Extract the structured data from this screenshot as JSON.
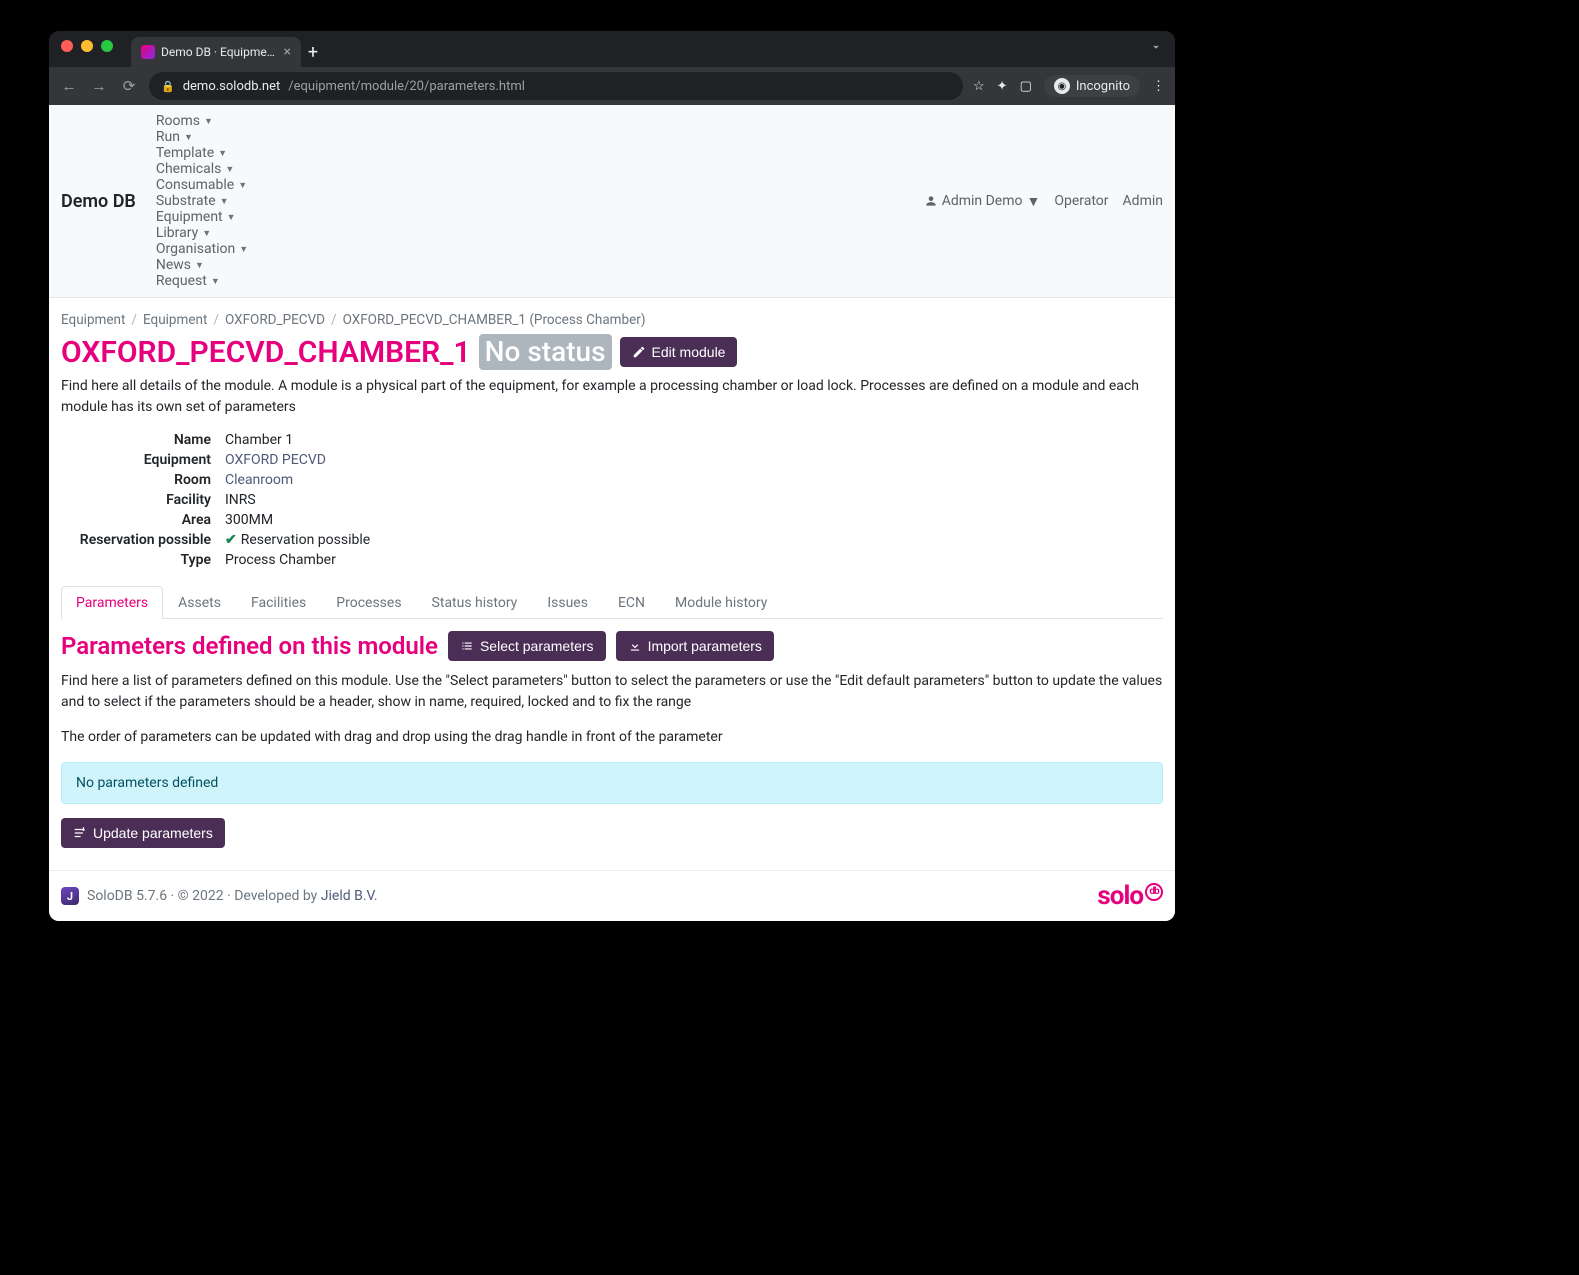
{
  "window": {
    "tab_title": "Demo DB · Equipment · Module",
    "incognito_label": "Incognito"
  },
  "url": {
    "host": "demo.solodb.net",
    "path": "/equipment/module/20/parameters.html"
  },
  "navbar": {
    "brand": "Demo DB",
    "items": [
      "Rooms",
      "Run",
      "Template",
      "Chemicals",
      "Consumable",
      "Substrate",
      "Equipment",
      "Library",
      "Organisation",
      "News",
      "Request"
    ],
    "user_label": "Admin Demo",
    "links": [
      "Operator",
      "Admin"
    ]
  },
  "breadcrumb": {
    "items": [
      "Equipment",
      "Equipment",
      "OXFORD_PECVD"
    ],
    "active": "OXFORD_PECVD_CHAMBER_1 (Process Chamber)"
  },
  "header": {
    "title": "OXFORD_PECVD_CHAMBER_1",
    "status": "No status",
    "edit_label": "Edit module",
    "lead": "Find here all details of the module. A module is a physical part of the equipment, for example a processing chamber or load lock. Processes are defined on a module and each module has its own set of parameters"
  },
  "details": {
    "rows": [
      {
        "label": "Name",
        "value": "Chamber 1"
      },
      {
        "label": "Equipment",
        "value": "OXFORD PECVD",
        "link": true
      },
      {
        "label": "Room",
        "value": "Cleanroom",
        "link": true
      },
      {
        "label": "Facility",
        "value": "INRS"
      },
      {
        "label": "Area",
        "value": "300MM"
      },
      {
        "label": "Reservation possible",
        "value": "Reservation possible",
        "check": true
      },
      {
        "label": "Type",
        "value": "Process Chamber"
      }
    ]
  },
  "tabs": [
    "Parameters",
    "Assets",
    "Facilities",
    "Processes",
    "Status history",
    "Issues",
    "ECN",
    "Module history"
  ],
  "tabs_active_index": 0,
  "params": {
    "title": "Parameters defined on this module",
    "select_label": "Select parameters",
    "import_label": "Import parameters",
    "desc1": "Find here a list of parameters defined on this module. Use the \"Select parameters\" button to select the parameters or use the \"Edit default parameters\" button to update the values and to select if the parameters should be a header, show in name, required, locked and to fix the range",
    "desc2": "The order of parameters can be updated with drag and drop using the drag handle in front of the parameter",
    "empty": "No parameters defined",
    "update_label": "Update parameters"
  },
  "footer": {
    "text": "SoloDB 5.7.6 · © 2022 · Developed by ",
    "dev": "Jield B.V.",
    "logo_main": "solo",
    "logo_sub": "db"
  }
}
